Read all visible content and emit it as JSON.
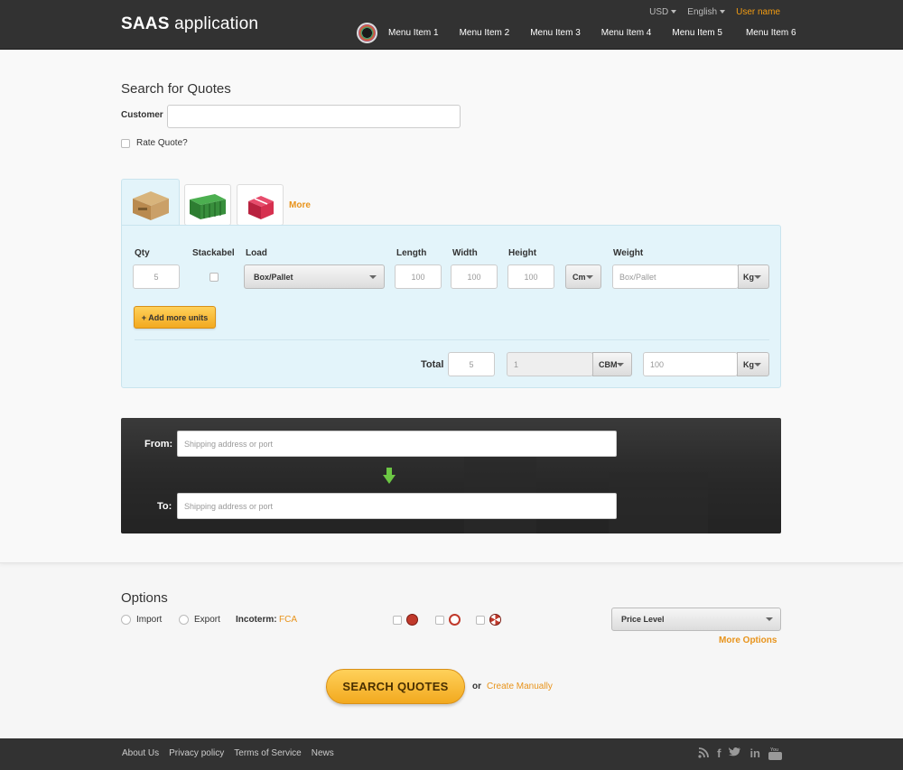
{
  "header": {
    "logo_bold": "SAAS",
    "logo_rest": " application",
    "currency": "USD",
    "language": "English",
    "user": "User name",
    "menu": [
      "Menu Item 1",
      "Menu Item 2",
      "Menu Item 3",
      "Menu Item 4",
      "Menu Item 5",
      "Menu Item 6"
    ]
  },
  "search": {
    "title": "Search for Quotes",
    "customer_label": "Customer",
    "customer_value": "",
    "rate_quote_label": "Rate Quote?",
    "more_link": "More"
  },
  "tabs": [
    {
      "name": "box-tab",
      "icon": "cardboard-box-icon"
    },
    {
      "name": "container-tab",
      "icon": "shipping-container-icon"
    },
    {
      "name": "gift-tab",
      "icon": "gift-box-icon"
    }
  ],
  "units": {
    "headers": {
      "qty": "Qty",
      "stackable": "Stackabel",
      "load": "Load",
      "length": "Length",
      "width": "Width",
      "height": "Height",
      "weight": "Weight"
    },
    "row": {
      "qty": "5",
      "load": "Box/Pallet",
      "length": "100",
      "width": "100",
      "height": "100",
      "dim_unit": "Cm",
      "weight_placeholder": "Box/Pallet",
      "weight_unit": "Kg"
    },
    "add_button": "+ Add more units",
    "total_label": "Total",
    "total_qty": "5",
    "total_volume": "1",
    "volume_unit": "CBM",
    "total_weight": "100",
    "total_weight_unit": "Kg"
  },
  "route": {
    "from_label": "From:",
    "from_placeholder": "Shipping address or port",
    "to_label": "To:",
    "to_placeholder": "Shipping address or port"
  },
  "options": {
    "title": "Options",
    "import_label": "Import",
    "export_label": "Export",
    "incoterm_label": "Incoterm:",
    "incoterm_value": "FCA",
    "price_level": "Price Level",
    "more_options": "More Options"
  },
  "actions": {
    "search_button": "SEARCH QUOTES",
    "or_text": "or",
    "create_manually": "Create Manually"
  },
  "footer": {
    "links": [
      "About Us",
      "Privacy policy",
      "Terms of Service",
      "News"
    ],
    "social": [
      "rss-icon",
      "facebook-icon",
      "twitter-icon",
      "linkedin-icon",
      "youtube-icon"
    ]
  },
  "colors": {
    "accent": "#e8931a",
    "header_bg": "#323232",
    "panel_bg": "#e3f4fa"
  }
}
